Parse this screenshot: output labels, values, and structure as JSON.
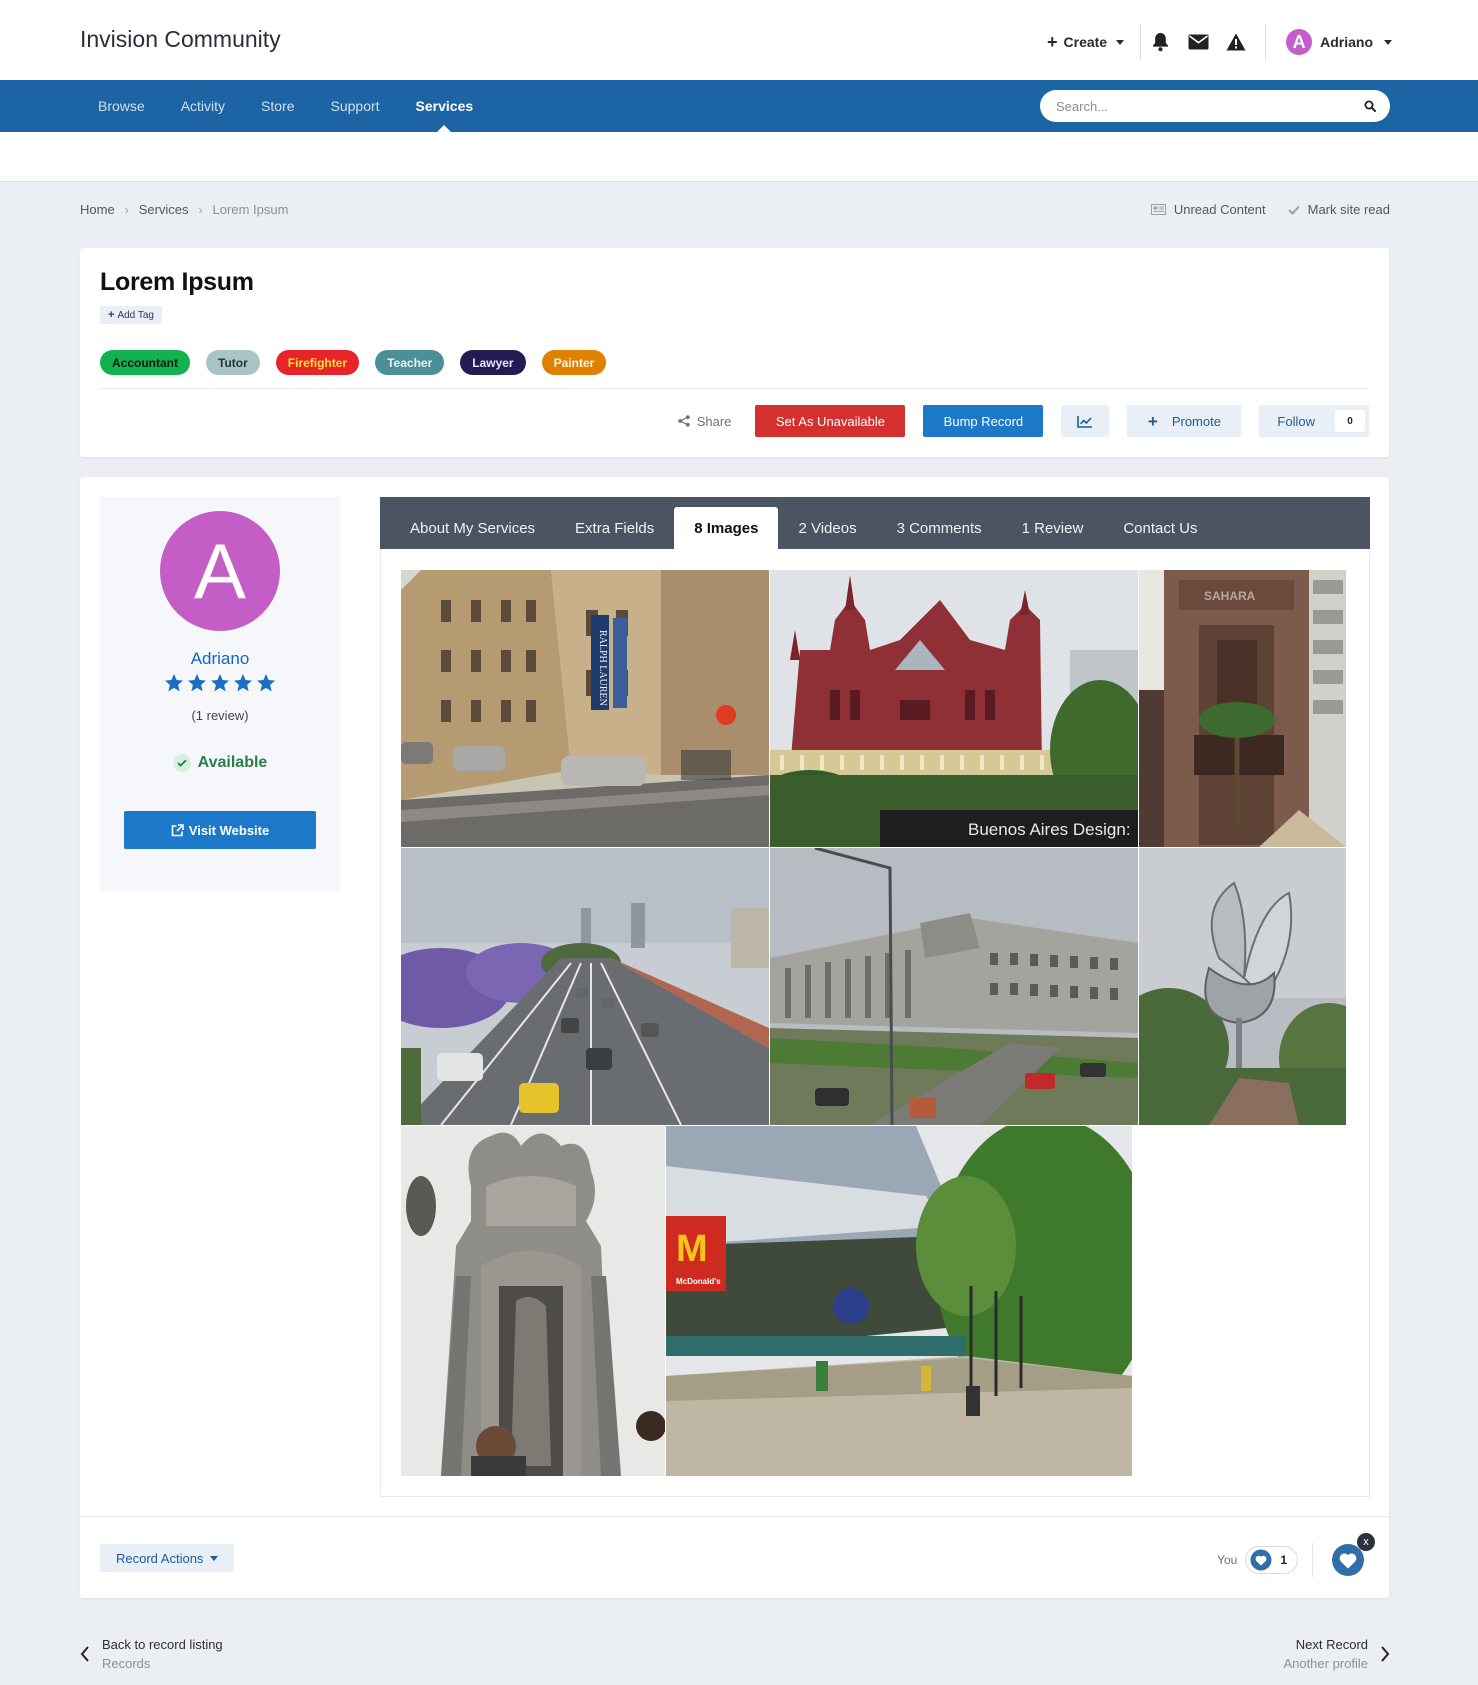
{
  "site": {
    "title": "Invision Community"
  },
  "topbar": {
    "create_label": "Create",
    "user_name": "Adriano",
    "user_initial": "A"
  },
  "nav": {
    "items": [
      "Browse",
      "Activity",
      "Store",
      "Support",
      "Services"
    ],
    "active": "Services"
  },
  "search": {
    "placeholder": "Search..."
  },
  "breadcrumb": [
    "Home",
    "Services",
    "Lorem Ipsum"
  ],
  "util_links": {
    "unread": "Unread Content",
    "mark_read": "Mark site read"
  },
  "record": {
    "title": "Lorem Ipsum",
    "add_tag": "Add Tag",
    "tags": [
      {
        "label": "Accountant",
        "bg": "#12b24f",
        "fg": "#0a1a10"
      },
      {
        "label": "Tutor",
        "bg": "#a9c4c7",
        "fg": "#25303a"
      },
      {
        "label": "Firefighter",
        "bg": "#e8242a",
        "fg": "#ffe23a"
      },
      {
        "label": "Teacher",
        "bg": "#4d8f96",
        "fg": "#e9f3f3"
      },
      {
        "label": "Lawyer",
        "bg": "#241b55",
        "fg": "#e6e6f2"
      },
      {
        "label": "Painter",
        "bg": "#de8000",
        "fg": "#fff7e6"
      }
    ],
    "actions": {
      "share": "Share",
      "set_unavailable": "Set As Unavailable",
      "bump": "Bump Record",
      "promote": "Promote",
      "follow": "Follow",
      "follow_count": "0"
    }
  },
  "author": {
    "initial": "A",
    "name": "Adriano",
    "rating": 5,
    "review_count": "(1 review)",
    "availability": "Available",
    "visit_label": "Visit Website"
  },
  "tabs": [
    "About My Services",
    "Extra Fields",
    "8 Images",
    "2 Videos",
    "3 Comments",
    "1 Review",
    "Contact Us"
  ],
  "active_tab": "8 Images",
  "images": [
    {
      "name": "street-ralph-lauren-photo",
      "sign_text": "RALPH LAUREN"
    },
    {
      "name": "red-church-photo",
      "sign_text": "Buenos Aires Design:"
    },
    {
      "name": "stone-building-facade-photo",
      "sign_text": "SAHARA"
    },
    {
      "name": "avenue-jacaranda-photo",
      "sign_text": ""
    },
    {
      "name": "law-faculty-building-photo",
      "sign_text": ""
    },
    {
      "name": "floralis-generica-photo",
      "sign_text": ""
    },
    {
      "name": "cemetery-mausoleum-photo",
      "sign_text": ""
    },
    {
      "name": "mcdonalds-plaza-photo",
      "sign_text": "McDonald's"
    }
  ],
  "footer": {
    "record_actions": "Record Actions",
    "reactions_by": "You",
    "reaction_count": "1",
    "reaction_close": "x"
  },
  "pager": {
    "prev_title": "Back to record listing",
    "prev_sub": "Records",
    "next_title": "Next Record",
    "next_sub": "Another profile"
  },
  "colors": {
    "brand_blue": "#1c64a4",
    "button_blue": "#1c78c8",
    "danger": "#d3302f",
    "avatar": "#c55dc6"
  }
}
